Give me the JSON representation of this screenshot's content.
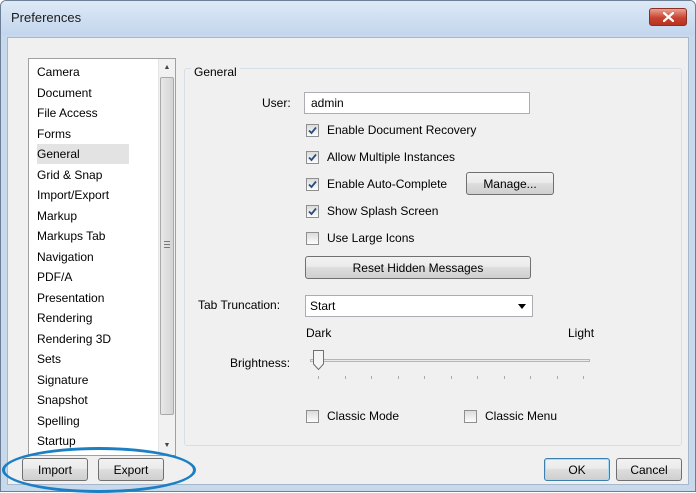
{
  "window": {
    "title": "Preferences"
  },
  "sidebar": {
    "items": [
      {
        "label": "Camera"
      },
      {
        "label": "Document"
      },
      {
        "label": "File Access"
      },
      {
        "label": "Forms"
      },
      {
        "label": "General",
        "selected": true
      },
      {
        "label": "Grid & Snap"
      },
      {
        "label": "Import/Export"
      },
      {
        "label": "Markup"
      },
      {
        "label": "Markups Tab"
      },
      {
        "label": "Navigation"
      },
      {
        "label": "PDF/A"
      },
      {
        "label": "Presentation"
      },
      {
        "label": "Rendering"
      },
      {
        "label": "Rendering 3D"
      },
      {
        "label": "Sets"
      },
      {
        "label": "Signature"
      },
      {
        "label": "Snapshot"
      },
      {
        "label": "Spelling"
      },
      {
        "label": "Startup"
      }
    ]
  },
  "general": {
    "group_title": "General",
    "user_label": "User:",
    "user_value": "admin",
    "options": {
      "doc_recovery": {
        "label": "Enable Document Recovery",
        "checked": true
      },
      "multi_instances": {
        "label": "Allow Multiple Instances",
        "checked": true
      },
      "auto_complete": {
        "label": "Enable Auto-Complete",
        "checked": true
      },
      "splash": {
        "label": "Show Splash Screen",
        "checked": true
      },
      "large_icons": {
        "label": "Use Large Icons",
        "checked": false
      }
    },
    "manage_label": "Manage...",
    "reset_label": "Reset Hidden Messages",
    "tab_truncation_label": "Tab Truncation:",
    "tab_truncation_value": "Start",
    "dark_label": "Dark",
    "light_label": "Light",
    "brightness_label": "Brightness:",
    "brightness_value": 0,
    "classic_mode": {
      "label": "Classic Mode",
      "checked": false
    },
    "classic_menu": {
      "label": "Classic Menu",
      "checked": false
    }
  },
  "footer": {
    "import_label": "Import",
    "export_label": "Export",
    "ok_label": "OK",
    "cancel_label": "Cancel"
  },
  "colors": {
    "highlight": "#1c7fc4",
    "close_button": "#c9442f"
  }
}
